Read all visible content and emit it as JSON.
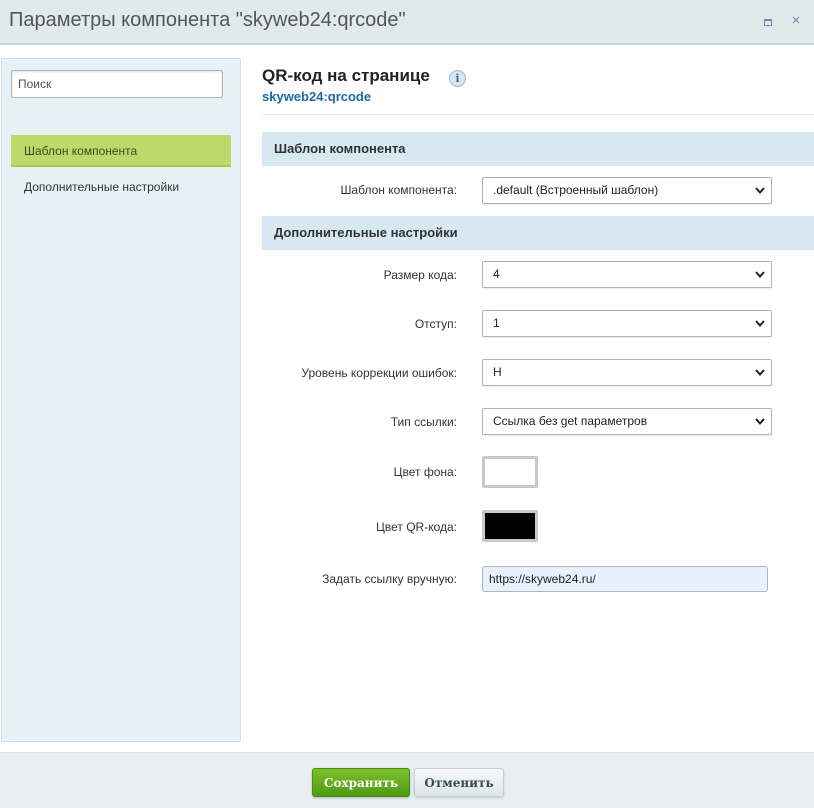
{
  "window": {
    "title": "Параметры компонента \"skyweb24:qrcode\"",
    "maximize_glyph": "□",
    "close_glyph": "×"
  },
  "sidebar": {
    "search_placeholder": "Поиск",
    "items": [
      {
        "label": "Шаблон компонента",
        "active": true
      },
      {
        "label": "Дополнительные настройки",
        "active": false
      }
    ]
  },
  "main": {
    "title": "QR-код на странице",
    "info_glyph": "i",
    "subtitle": "skyweb24:qrcode",
    "sections": [
      {
        "title": "Шаблон компонента",
        "fields": [
          {
            "label": "Шаблон компонента:",
            "type": "select",
            "value": ".default (Встроенный шаблон)"
          }
        ]
      },
      {
        "title": "Дополнительные настройки",
        "fields": [
          {
            "label": "Размер кода:",
            "type": "select",
            "value": "4"
          },
          {
            "label": "Отступ:",
            "type": "select",
            "value": "1"
          },
          {
            "label": "Уровень коррекции ошибок:",
            "type": "select",
            "value": "H"
          },
          {
            "label": "Тип ссылки:",
            "type": "select",
            "value": "Ссылка без get параметров"
          },
          {
            "label": "Цвет фона:",
            "type": "color",
            "value": "#ffffff"
          },
          {
            "label": "Цвет QR-кода:",
            "type": "color",
            "value": "#000000"
          },
          {
            "label": "Задать ссылку вручную:",
            "type": "text",
            "value": "https://skyweb24.ru/"
          }
        ]
      }
    ]
  },
  "footer": {
    "save_label": "Сохранить",
    "cancel_label": "Отменить"
  },
  "colors": {
    "accent_green": "#bcd96b",
    "section_bg": "#d8e8f3",
    "link_blue": "#1a6aa0",
    "save_button": "#5fa81c"
  },
  "icons": [
    "maximize-icon",
    "close-icon",
    "info-icon",
    "chevron-down-icon"
  ]
}
